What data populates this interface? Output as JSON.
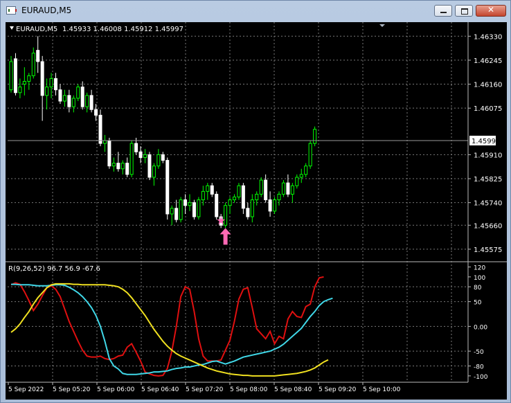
{
  "window": {
    "title": "EURAUD,M5",
    "close_glyph": "✕"
  },
  "chart_header": {
    "symbol_label": "EURAUD,M5",
    "ohlc": "1.45933 1.46008 1.45912 1.45997"
  },
  "price_axis": {
    "ticks": [
      "1.46330",
      "1.46245",
      "1.46160",
      "1.46075",
      "1.45997",
      "1.45910",
      "1.45825",
      "1.45740",
      "1.45660",
      "1.45575"
    ],
    "current_price": "1.45997"
  },
  "indicator": {
    "label": "R(9,26,52) 96.7 56.9 -67.6",
    "ticks": [
      "120",
      "100",
      "80",
      "50",
      "0.00",
      "-50",
      "-80",
      "-100"
    ]
  },
  "time_axis": {
    "labels": [
      "5 Sep 2022",
      "5 Sep 05:20",
      "5 Sep 06:00",
      "5 Sep 06:40",
      "5 Sep 07:20",
      "5 Sep 08:00",
      "5 Sep 08:40",
      "5 Sep 09:20",
      "5 Sep 10:00"
    ]
  },
  "colors": {
    "background": "#000000",
    "bull_candle": "#00ff00",
    "bear_candle": "#ffffff",
    "line_fast": "#e01010",
    "line_mid": "#40d8e8",
    "line_slow": "#f0e020",
    "signal_arrow": "#ff69b4",
    "signal_star": "#ff69b4"
  },
  "markers": {
    "star": "star-marker",
    "arrow": "up-arrow-marker"
  },
  "chart_data": [
    {
      "type": "candlestick",
      "title": "EURAUD,M5",
      "ylim": [
        1.45575,
        1.4633
      ],
      "current_price": 1.45997,
      "candles": [
        [
          1.4614,
          1.4626,
          1.4613,
          1.4624
        ],
        [
          1.4625,
          1.4627,
          1.4612,
          1.4613
        ],
        [
          1.4613,
          1.4618,
          1.4611,
          1.4615
        ],
        [
          1.4616,
          1.4622,
          1.4612,
          1.4617
        ],
        [
          1.4617,
          1.462,
          1.4614,
          1.4619
        ],
        [
          1.4619,
          1.4629,
          1.4618,
          1.4627
        ],
        [
          1.4628,
          1.4633,
          1.462,
          1.4624
        ],
        [
          1.4624,
          1.4626,
          1.4603,
          1.4612
        ],
        [
          1.4612,
          1.4618,
          1.4607,
          1.4615
        ],
        [
          1.4615,
          1.462,
          1.4611,
          1.4618
        ],
        [
          1.4618,
          1.462,
          1.4612,
          1.4614
        ],
        [
          1.4614,
          1.4616,
          1.4609,
          1.461
        ],
        [
          1.461,
          1.4614,
          1.4608,
          1.4612
        ],
        [
          1.4612,
          1.4614,
          1.4606,
          1.4608
        ],
        [
          1.4608,
          1.4612,
          1.4606,
          1.4611
        ],
        [
          1.4611,
          1.4616,
          1.461,
          1.4615
        ],
        [
          1.4615,
          1.4617,
          1.4607,
          1.4608
        ],
        [
          1.4608,
          1.4613,
          1.4606,
          1.4612
        ],
        [
          1.4612,
          1.4614,
          1.4606,
          1.4607
        ],
        [
          1.4607,
          1.4609,
          1.4603,
          1.4605
        ],
        [
          1.4605,
          1.4607,
          1.4594,
          1.4595
        ],
        [
          1.4595,
          1.4598,
          1.4592,
          1.4596
        ],
        [
          1.4596,
          1.4597,
          1.4586,
          1.4587
        ],
        [
          1.4587,
          1.459,
          1.4585,
          1.4588
        ],
        [
          1.4588,
          1.4592,
          1.4585,
          1.4586
        ],
        [
          1.4586,
          1.4589,
          1.4584,
          1.4588
        ],
        [
          1.4588,
          1.459,
          1.4583,
          1.4584
        ],
        [
          1.4584,
          1.4596,
          1.4583,
          1.4595
        ],
        [
          1.4595,
          1.4597,
          1.4591,
          1.4592
        ],
        [
          1.4592,
          1.4594,
          1.4588,
          1.459
        ],
        [
          1.459,
          1.4593,
          1.4588,
          1.4591
        ],
        [
          1.4591,
          1.4592,
          1.4582,
          1.4583
        ],
        [
          1.4583,
          1.4588,
          1.458,
          1.4587
        ],
        [
          1.4587,
          1.4593,
          1.4586,
          1.4591
        ],
        [
          1.4591,
          1.4592,
          1.4588,
          1.4589
        ],
        [
          1.4589,
          1.459,
          1.4568,
          1.457
        ],
        [
          1.457,
          1.4573,
          1.4566,
          1.4572
        ],
        [
          1.4572,
          1.4575,
          1.4567,
          1.4568
        ],
        [
          1.4568,
          1.4576,
          1.4567,
          1.4575
        ],
        [
          1.4575,
          1.4577,
          1.457,
          1.4573
        ],
        [
          1.4573,
          1.4577,
          1.4571,
          1.4574
        ],
        [
          1.4574,
          1.4575,
          1.4568,
          1.4569
        ],
        [
          1.4569,
          1.4576,
          1.4568,
          1.4575
        ],
        [
          1.4575,
          1.458,
          1.4573,
          1.4578
        ],
        [
          1.4578,
          1.4581,
          1.4575,
          1.458
        ],
        [
          1.458,
          1.4581,
          1.4576,
          1.4577
        ],
        [
          1.4577,
          1.4578,
          1.4568,
          1.4569
        ],
        [
          1.4569,
          1.457,
          1.4565,
          1.4566
        ],
        [
          1.4566,
          1.4574,
          1.4565,
          1.4573
        ],
        [
          1.4573,
          1.4576,
          1.457,
          1.4575
        ],
        [
          1.4575,
          1.4577,
          1.4574,
          1.4576
        ],
        [
          1.4576,
          1.4581,
          1.4575,
          1.458
        ],
        [
          1.458,
          1.4581,
          1.457,
          1.4572
        ],
        [
          1.4572,
          1.4574,
          1.4568,
          1.4569
        ],
        [
          1.4569,
          1.4577,
          1.4567,
          1.4575
        ],
        [
          1.4575,
          1.4578,
          1.4573,
          1.4577
        ],
        [
          1.4577,
          1.4583,
          1.4576,
          1.4582
        ],
        [
          1.4582,
          1.4584,
          1.4574,
          1.4575
        ],
        [
          1.4575,
          1.4578,
          1.4569,
          1.4571
        ],
        [
          1.4571,
          1.4576,
          1.457,
          1.4575
        ],
        [
          1.4575,
          1.4578,
          1.4573,
          1.4577
        ],
        [
          1.4577,
          1.4582,
          1.4576,
          1.4581
        ],
        [
          1.4581,
          1.4584,
          1.4576,
          1.4577
        ],
        [
          1.4577,
          1.4581,
          1.4574,
          1.458
        ],
        [
          1.458,
          1.4584,
          1.4579,
          1.4583
        ],
        [
          1.4583,
          1.4586,
          1.4581,
          1.4584
        ],
        [
          1.4584,
          1.4588,
          1.4583,
          1.4587
        ],
        [
          1.4587,
          1.4596,
          1.4586,
          1.4595
        ],
        [
          1.4595,
          1.4601,
          1.4594,
          1.46
        ]
      ],
      "markers": [
        {
          "type": "star",
          "index": 47,
          "price": 1.45675
        },
        {
          "type": "up-arrow",
          "index": 48,
          "price": 1.4565
        }
      ]
    },
    {
      "type": "line",
      "title": "R(9,26,52) 96.7 56.9 -67.6",
      "ylim": [
        -100,
        120
      ],
      "yticks": [
        120,
        100,
        80,
        50,
        0,
        -50,
        -80,
        -100
      ],
      "series": [
        {
          "name": "R(9)",
          "color": "#e01010",
          "values": [
            84,
            88,
            85,
            70,
            52,
            32,
            45,
            62,
            78,
            82,
            75,
            60,
            35,
            10,
            -10,
            -30,
            -48,
            -60,
            -62,
            -62,
            -60,
            -65,
            -67,
            -65,
            -60,
            -58,
            -42,
            -35,
            -52,
            -70,
            -92,
            -96,
            -99,
            -100,
            -99,
            -85,
            -50,
            0,
            60,
            80,
            75,
            30,
            -25,
            -60,
            -70,
            -70,
            -70,
            -68,
            -48,
            -28,
            10,
            55,
            75,
            78,
            38,
            -5,
            -15,
            -25,
            -10,
            -35,
            -20,
            -25,
            15,
            30,
            20,
            18,
            40,
            45,
            80,
            98,
            100
          ]
        },
        {
          "name": "R(26)",
          "color": "#40d8e8",
          "values": [
            85,
            85,
            84,
            84,
            84,
            83,
            82,
            82,
            82,
            83,
            84,
            84,
            83,
            79,
            74,
            68,
            60,
            50,
            38,
            22,
            0,
            -30,
            -65,
            -80,
            -86,
            -95,
            -97,
            -97,
            -97,
            -96,
            -95,
            -94,
            -92,
            -92,
            -91,
            -90,
            -87,
            -85,
            -84,
            -82,
            -82,
            -80,
            -78,
            -77,
            -74,
            -71,
            -70,
            -73,
            -76,
            -73,
            -70,
            -66,
            -62,
            -60,
            -58,
            -56,
            -54,
            -52,
            -50,
            -46,
            -42,
            -36,
            -28,
            -20,
            -12,
            -4,
            8,
            20,
            30,
            42,
            50,
            54,
            56.9
          ]
        },
        {
          "name": "R(52)",
          "color": "#f0e020",
          "values": [
            -12,
            -5,
            5,
            18,
            30,
            45,
            58,
            68,
            78,
            84,
            86,
            86,
            86,
            86,
            85,
            85,
            84,
            84,
            84,
            84,
            84,
            84,
            83,
            82,
            80,
            75,
            68,
            58,
            46,
            34,
            22,
            8,
            -6,
            -18,
            -30,
            -40,
            -48,
            -55,
            -60,
            -64,
            -68,
            -72,
            -76,
            -80,
            -84,
            -87,
            -90,
            -92,
            -94,
            -96,
            -97,
            -98,
            -99,
            -99,
            -100,
            -100,
            -100,
            -100,
            -100,
            -100,
            -99,
            -98,
            -97,
            -96,
            -95,
            -93,
            -91,
            -88,
            -84,
            -78,
            -72,
            -67.6
          ]
        }
      ]
    }
  ]
}
